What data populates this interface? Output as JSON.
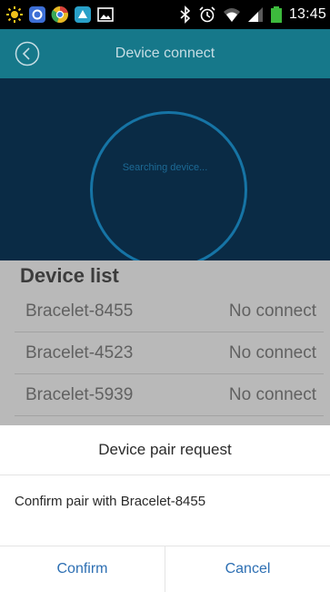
{
  "status_bar": {
    "time": "13:45",
    "left_icons": [
      "sun-icon",
      "app-icon",
      "chrome-icon",
      "app-icon",
      "image-icon"
    ],
    "right_icons": [
      "bluetooth-icon",
      "alarm-icon",
      "wifi-icon",
      "signal-icon",
      "battery-icon"
    ]
  },
  "header": {
    "title": "Device connect",
    "back_icon": "back-icon"
  },
  "scanner": {
    "status_text": "Searching device..."
  },
  "device_list": {
    "heading": "Device list",
    "items": [
      {
        "name": "Bracelet-8455",
        "status": "No connect"
      },
      {
        "name": "Bracelet-4523",
        "status": "No connect"
      },
      {
        "name": "Bracelet-5939",
        "status": "No connect"
      }
    ]
  },
  "dialog": {
    "title": "Device pair request",
    "message": "Confirm pair with Bracelet-8455",
    "confirm_label": "Confirm",
    "cancel_label": "Cancel"
  },
  "colors": {
    "header_bg": "#16788a",
    "scan_bg": "#0a2b45",
    "dim_bg": "#b9b9b9",
    "button_text": "#2d6fb3"
  }
}
